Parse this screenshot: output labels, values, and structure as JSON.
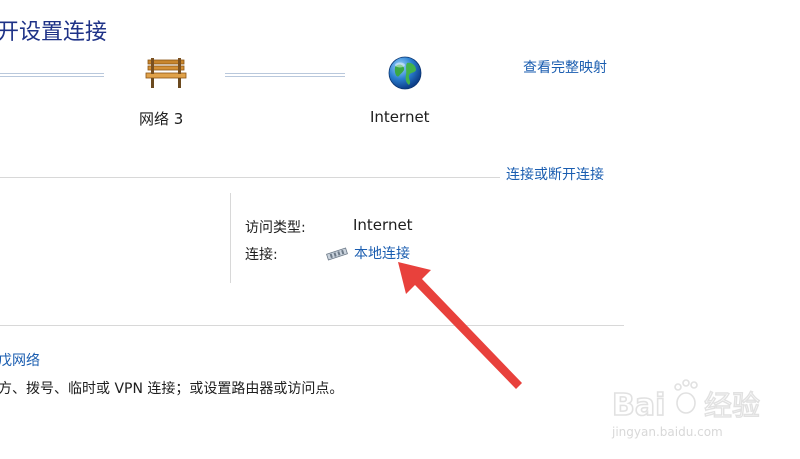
{
  "page": {
    "heading": "开设置连接"
  },
  "network_map": {
    "view_full_map_link": "查看完整映射",
    "network_name": "网络 3",
    "internet_label": "Internet",
    "network_icon": "bench-icon",
    "internet_icon": "globe-icon"
  },
  "active_network": {
    "connect_disconnect_link": "连接或断开连接",
    "access_type_label": "访问类型:",
    "access_type_value": "Internet",
    "connections_label": "连接:",
    "connection_icon": "network-adapter-icon",
    "connection_link": "本地连接"
  },
  "change_settings": {
    "setup_link": "戊网络",
    "setup_description": "方、拨号、临时或 VPN 连接；或设置路由器或访问点。"
  },
  "overlay": {
    "arrow_color": "#e8413c",
    "watermark_text": "Bai 经验",
    "watermark_url": "jingyan.baidu.com"
  },
  "colors": {
    "link": "#1a5db0",
    "heading": "#1e3287"
  }
}
